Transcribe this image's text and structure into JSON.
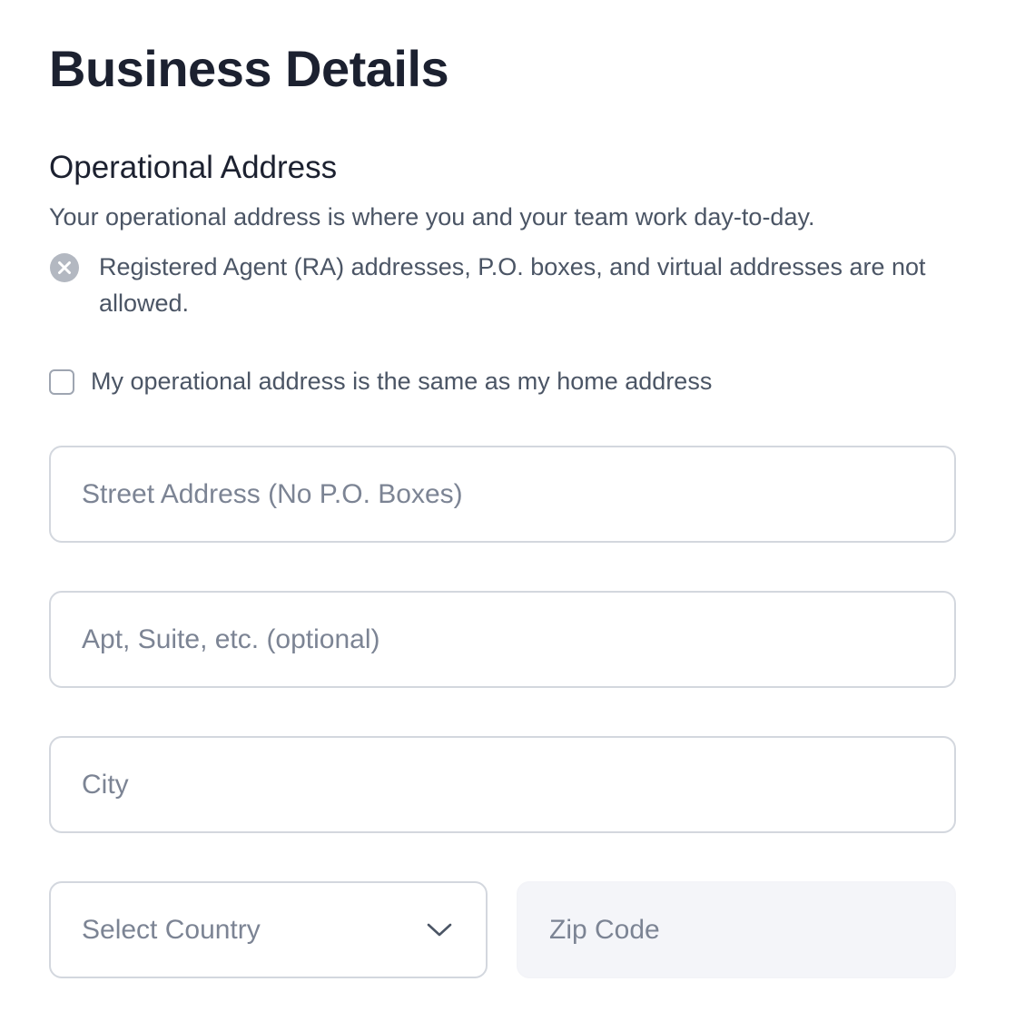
{
  "page": {
    "title": "Business Details"
  },
  "section": {
    "title": "Operational Address",
    "description": "Your operational address is where you and your team work day-to-day.",
    "rule": {
      "icon": "x-circle-icon",
      "text": "Registered Agent (RA) addresses, P.O. boxes, and virtual addresses are not allowed."
    }
  },
  "same_as_home": {
    "label": "My operational address is the same as my home address",
    "checked": false
  },
  "fields": {
    "street": {
      "placeholder": "Street Address (No P.O. Boxes)",
      "value": ""
    },
    "apt": {
      "placeholder": "Apt, Suite, etc. (optional)",
      "value": ""
    },
    "city": {
      "placeholder": "City",
      "value": ""
    },
    "country": {
      "selected": "Select Country",
      "icon": "chevron-down-icon"
    },
    "zip": {
      "placeholder": "Zip Code",
      "value": ""
    }
  },
  "colors": {
    "heading": "#1c2130",
    "body_text": "#4b5565",
    "placeholder": "#7c8494",
    "border": "#d3d7de",
    "disabled_bg": "#f4f5f9",
    "icon_gray": "#b3b8c1"
  }
}
